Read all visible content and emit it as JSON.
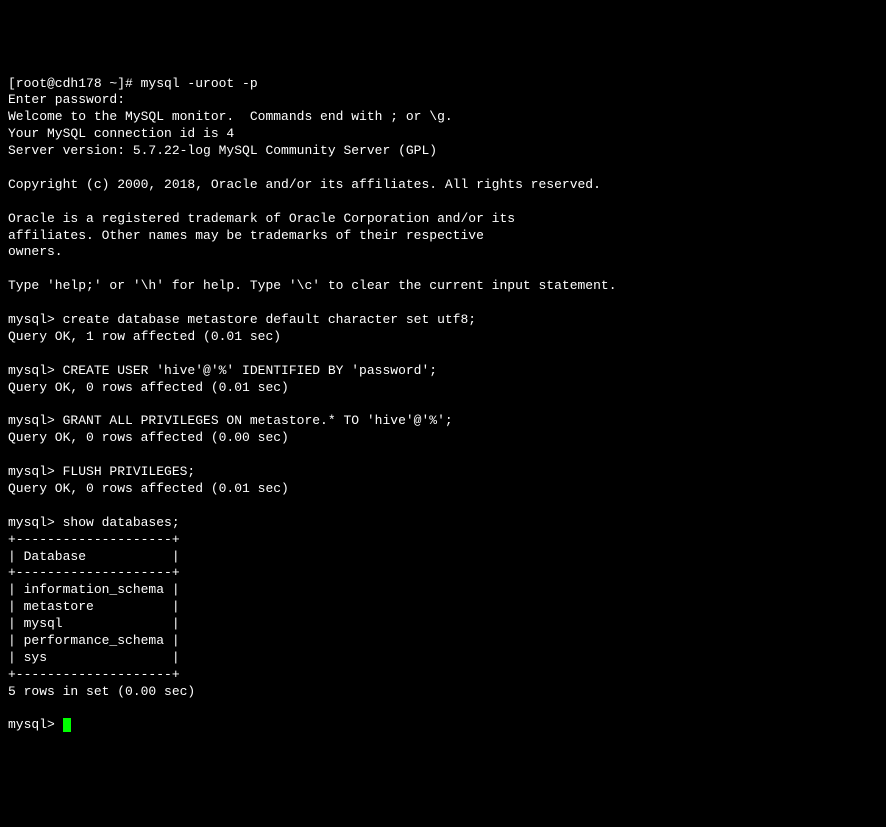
{
  "lines": [
    "[root@cdh178 ~]# mysql -uroot -p",
    "Enter password:",
    "Welcome to the MySQL monitor.  Commands end with ; or \\g.",
    "Your MySQL connection id is 4",
    "Server version: 5.7.22-log MySQL Community Server (GPL)",
    "",
    "Copyright (c) 2000, 2018, Oracle and/or its affiliates. All rights reserved.",
    "",
    "Oracle is a registered trademark of Oracle Corporation and/or its",
    "affiliates. Other names may be trademarks of their respective",
    "owners.",
    "",
    "Type 'help;' or '\\h' for help. Type '\\c' to clear the current input statement.",
    "",
    "mysql> create database metastore default character set utf8;",
    "Query OK, 1 row affected (0.01 sec)",
    "",
    "mysql> CREATE USER 'hive'@'%' IDENTIFIED BY 'password';",
    "Query OK, 0 rows affected (0.01 sec)",
    "",
    "mysql> GRANT ALL PRIVILEGES ON metastore.* TO 'hive'@'%';",
    "Query OK, 0 rows affected (0.00 sec)",
    "",
    "mysql> FLUSH PRIVILEGES;",
    "Query OK, 0 rows affected (0.01 sec)",
    "",
    "mysql> show databases;",
    "+--------------------+",
    "| Database           |",
    "+--------------------+",
    "| information_schema |",
    "| metastore          |",
    "| mysql              |",
    "| performance_schema |",
    "| sys                |",
    "+--------------------+",
    "5 rows in set (0.00 sec)",
    "",
    "mysql> "
  ],
  "prompt_cursor": true
}
